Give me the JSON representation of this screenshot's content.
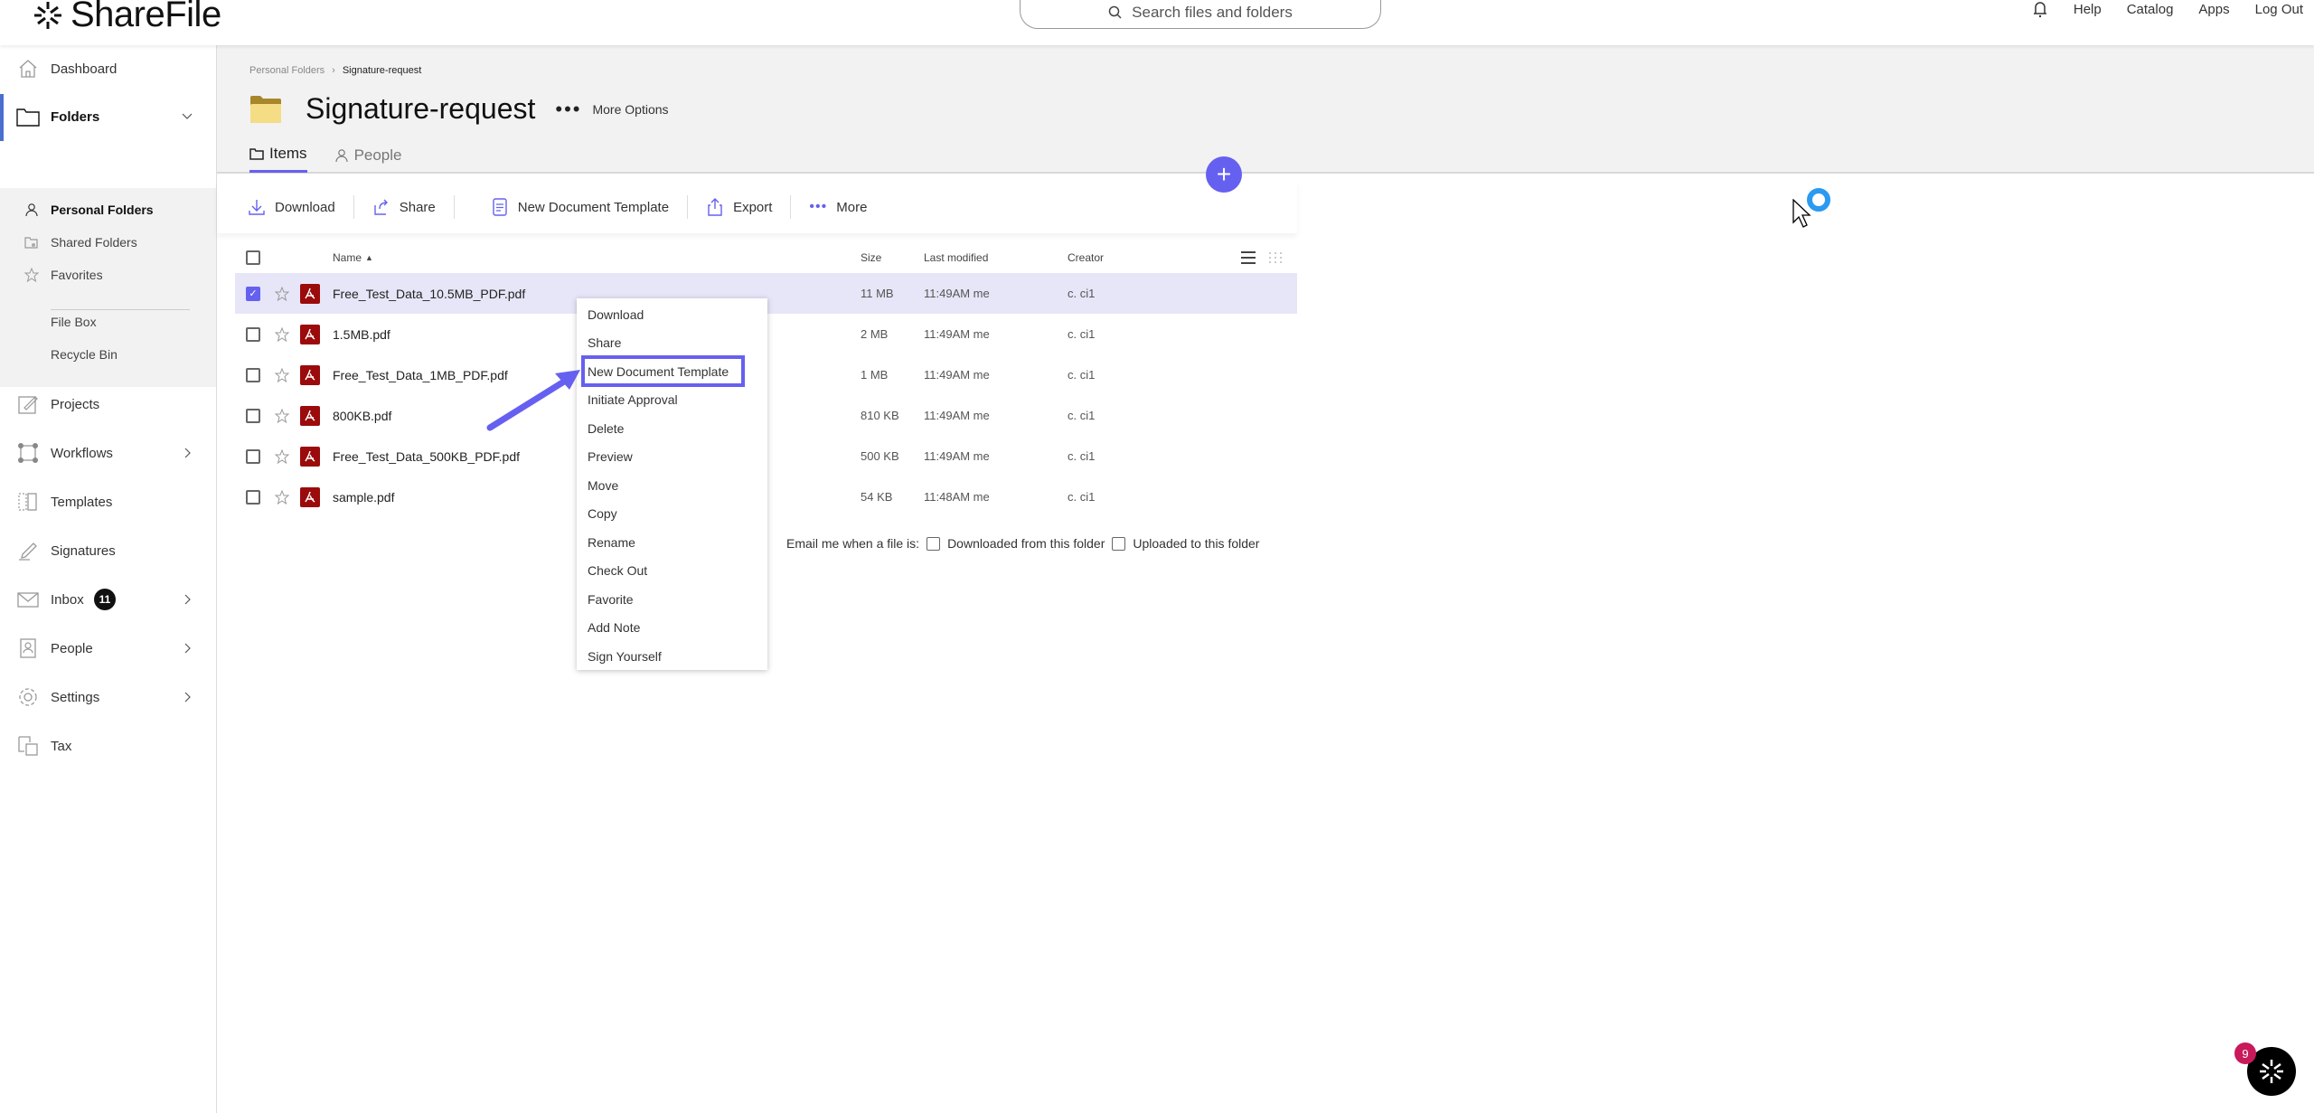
{
  "app": {
    "brand": "ShareFile",
    "search_placeholder": "Search files and folders",
    "top_links": [
      "Help",
      "Catalog",
      "Apps",
      "Log Out"
    ]
  },
  "sidebar": {
    "items": [
      {
        "label": "Dashboard",
        "icon": "home-icon"
      },
      {
        "label": "Folders",
        "icon": "folder-icon",
        "expanded": true,
        "active": true
      },
      {
        "label": "Projects",
        "icon": "projects-icon"
      },
      {
        "label": "Workflows",
        "icon": "workflows-icon",
        "has_children": true
      },
      {
        "label": "Templates",
        "icon": "templates-icon"
      },
      {
        "label": "Signatures",
        "icon": "signature-icon"
      },
      {
        "label": "Inbox",
        "icon": "mail-icon",
        "badge": "11",
        "has_children": true
      },
      {
        "label": "People",
        "icon": "contacts-icon",
        "has_children": true
      },
      {
        "label": "Settings",
        "icon": "gear-icon",
        "has_children": true
      },
      {
        "label": "Tax",
        "icon": "tax-icon"
      }
    ],
    "folders_sub": [
      {
        "label": "Personal Folders",
        "icon": "person-icon",
        "active": true
      },
      {
        "label": "Shared Folders",
        "icon": "shared-folder-icon"
      },
      {
        "label": "Favorites",
        "icon": "star-icon"
      },
      {
        "label": "File Box"
      },
      {
        "label": "Recycle Bin"
      }
    ]
  },
  "page": {
    "breadcrumb": [
      "Personal Folders",
      "Signature-request"
    ],
    "title": "Signature-request",
    "more_options": "More Options",
    "tabs": [
      {
        "label": "Items",
        "active": true
      },
      {
        "label": "People",
        "active": false
      }
    ]
  },
  "toolbar": {
    "download": "Download",
    "share": "Share",
    "new_doc_template": "New Document Template",
    "export": "Export",
    "more": "More"
  },
  "table": {
    "headers": {
      "name": "Name",
      "size": "Size",
      "modified": "Last modified",
      "creator": "Creator"
    },
    "sort": "name-ascending",
    "rows": [
      {
        "name": "Free_Test_Data_10.5MB_PDF.pdf",
        "size": "11 MB",
        "modified": "11:49AM me",
        "creator": "c. ci1",
        "selected": true
      },
      {
        "name": "1.5MB.pdf",
        "size": "2 MB",
        "modified": "11:49AM me",
        "creator": "c. ci1",
        "selected": false
      },
      {
        "name": "Free_Test_Data_1MB_PDF.pdf",
        "size": "1 MB",
        "modified": "11:49AM me",
        "creator": "c. ci1",
        "selected": false
      },
      {
        "name": "800KB.pdf",
        "size": "810 KB",
        "modified": "11:49AM me",
        "creator": "c. ci1",
        "selected": false
      },
      {
        "name": "Free_Test_Data_500KB_PDF.pdf",
        "size": "500 KB",
        "modified": "11:49AM me",
        "creator": "c. ci1",
        "selected": false
      },
      {
        "name": "sample.pdf",
        "size": "54 KB",
        "modified": "11:48AM me",
        "creator": "c. ci1",
        "selected": false
      }
    ]
  },
  "email_notify": {
    "label": "Email me when a file is:",
    "downloaded": "Downloaded from this folder",
    "uploaded": "Uploaded to this folder"
  },
  "context_menu": {
    "items": [
      "Download",
      "Share",
      "New Document Template",
      "Initiate Approval",
      "Delete",
      "Preview",
      "Move",
      "Copy",
      "Rename",
      "Check Out",
      "Favorite",
      "Add Note",
      "Sign Yourself"
    ],
    "highlighted": "New Document Template"
  },
  "help_widget": {
    "badge": "9"
  },
  "colors": {
    "accent": "#6660f0",
    "pdf_red": "#9b0b0b",
    "nav_active_bar": "#4a6fd0",
    "selected_row": "#e6e6f8",
    "notification": "#c8195a"
  }
}
